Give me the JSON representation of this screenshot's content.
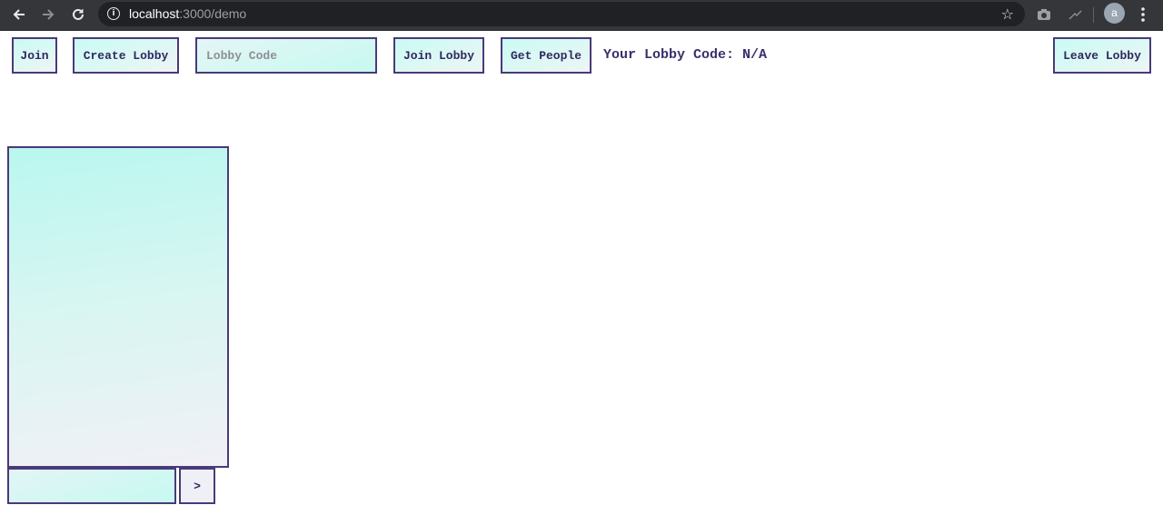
{
  "browser": {
    "url_host": "localhost",
    "url_path": ":3000/demo",
    "avatar_letter": "a",
    "icons": [
      "back-icon",
      "forward-icon",
      "reload-icon",
      "info-icon",
      "star-icon",
      "camera-icon",
      "extension-icon",
      "menu-icon"
    ]
  },
  "toolbar": {
    "join_label": "Join",
    "create_lobby_label": "Create Lobby",
    "lobby_code_placeholder": "Lobby Code",
    "lobby_code_value": "",
    "join_lobby_label": "Join Lobby",
    "get_people_label": "Get People",
    "lobby_code_text": "Your Lobby Code: N/A",
    "leave_lobby_label": "Leave Lobby"
  },
  "chat": {
    "input_value": "",
    "send_label": ">"
  },
  "colors": {
    "border": "#4a3a78",
    "text": "#2f2862",
    "gradient_top": "#b9f7ee",
    "gradient_bottom": "#f3f1f6",
    "chrome_bg": "#35363a",
    "omnibox_bg": "#202124"
  }
}
